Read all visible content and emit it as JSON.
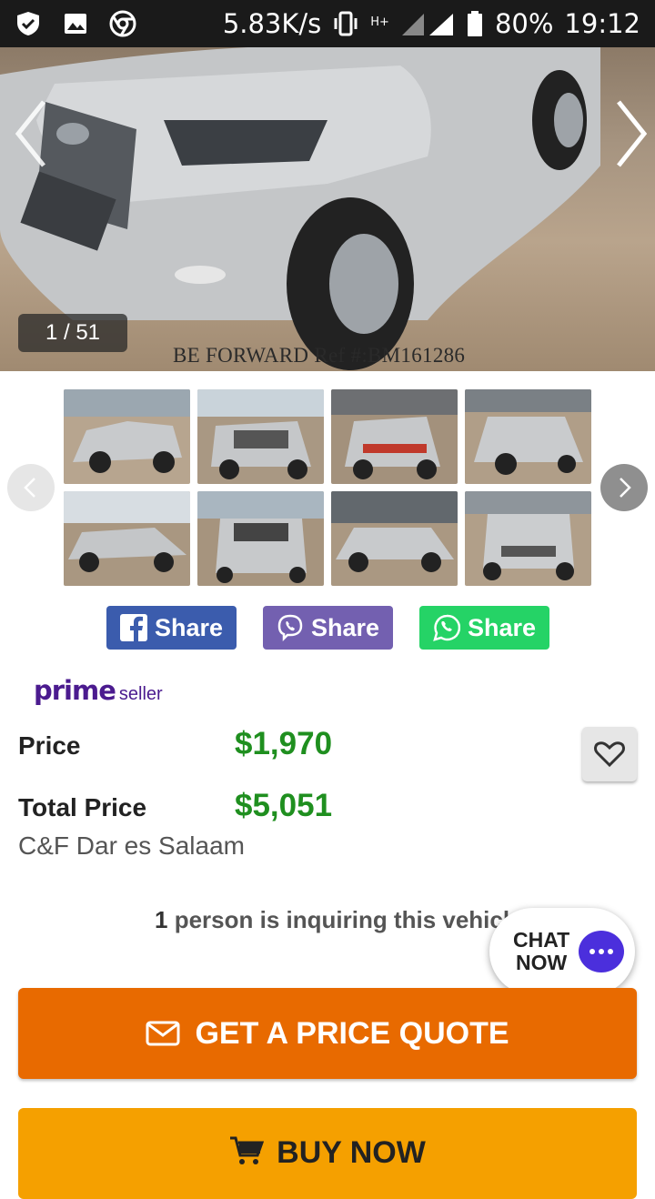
{
  "status_bar": {
    "net_speed": "5.83K/s",
    "network_type": "H+",
    "battery": "80%",
    "time": "19:12",
    "icons": [
      "shield-check-icon",
      "image-icon",
      "chrome-icon",
      "vibrate-icon",
      "signal-icon",
      "battery-icon"
    ]
  },
  "gallery": {
    "counter": "1 / 51",
    "watermark": "BE FORWARD Ref #:BM161286"
  },
  "share": {
    "facebook": "Share",
    "viber": "Share",
    "whatsapp": "Share",
    "colors": {
      "facebook": "#3b5cad",
      "viber": "#7360b0",
      "whatsapp": "#25d366"
    }
  },
  "prime_seller": {
    "prime": "prime",
    "seller": "seller"
  },
  "pricing": {
    "price_label": "Price",
    "price_value": "$1,970",
    "total_label": "Total Price",
    "total_value": "$5,051",
    "destination": "C&F Dar es Salaam"
  },
  "inquiry": {
    "count": "1",
    "text": " person is inquiring this vehicle"
  },
  "chat": {
    "line1": "CHAT",
    "line2": "NOW"
  },
  "actions": {
    "quote_label": "GET A PRICE QUOTE",
    "buy_label": "BUY NOW",
    "quote_color": "#e86a00",
    "buy_color": "#f5a000"
  }
}
